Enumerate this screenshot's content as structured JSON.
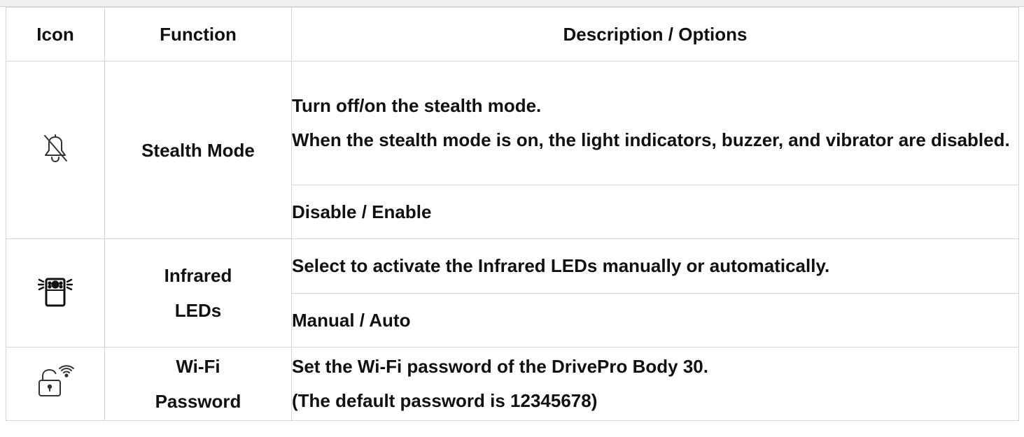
{
  "table": {
    "headers": {
      "icon": "Icon",
      "function": "Function",
      "description": "Description / Options"
    },
    "rows": [
      {
        "icon": "bell-off-icon",
        "function": "Stealth Mode",
        "description_lines": [
          "Turn off/on the stealth mode.",
          "When the stealth mode is on, the light indicators, buzzer, and vibrator are disabled."
        ],
        "options": "Disable / Enable"
      },
      {
        "icon": "infrared-camera-icon",
        "function_lines": [
          "Infrared",
          "LEDs"
        ],
        "description": "Select to activate the Infrared LEDs manually or automatically.",
        "options": "Manual / Auto"
      },
      {
        "icon": "wifi-lock-icon",
        "function_lines": [
          "Wi-Fi",
          "Password"
        ],
        "description_lines": [
          "Set the Wi-Fi password of the DrivePro Body 30.",
          "(The default password is 12345678)"
        ]
      }
    ]
  }
}
